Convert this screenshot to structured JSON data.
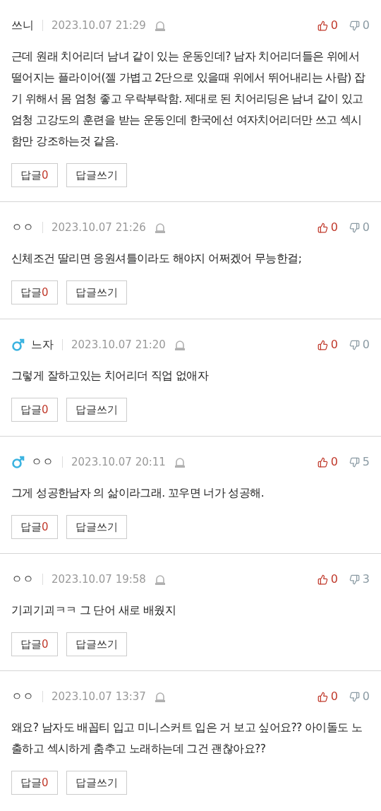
{
  "comments": [
    {
      "author": "쓰니",
      "male": false,
      "date": "2023.10.07 21:29",
      "likes": "0",
      "dislikes": "0",
      "text": "근데 원래 치어리더 남녀 같이 있는 운동인데? 남자 치어리더들은 위에서 떨어지는 플라이어(젤 가볍고 2단으로 있을때 위에서 뛰어내리는 사람) 잡기 위해서 몸 엄청 좋고 우락부락함. 제대로 된 치어리딩은 남녀 같이 있고 엄청 고강도의 훈련을 받는 운동인데 한국에선 여자치어리더만 쓰고 섹시함만 강조하는것 같음.",
      "reply_label": "답글",
      "reply_count": "0",
      "write_label": "답글쓰기"
    },
    {
      "author": "ㅇㅇ",
      "male": false,
      "date": "2023.10.07 21:26",
      "likes": "0",
      "dislikes": "0",
      "text": "신체조건 딸리면 응원셔틀이라도 해야지 어쩌겠어 무능한걸;",
      "reply_label": "답글",
      "reply_count": "0",
      "write_label": "답글쓰기"
    },
    {
      "author": "느자",
      "male": true,
      "date": "2023.10.07 21:20",
      "likes": "0",
      "dislikes": "0",
      "text": "그렇게 잘하고있는 치어리더 직업 없애자",
      "reply_label": "답글",
      "reply_count": "0",
      "write_label": "답글쓰기"
    },
    {
      "author": "ㅇㅇ",
      "male": true,
      "date": "2023.10.07 20:11",
      "likes": "0",
      "dislikes": "5",
      "text": "그게 성공한남자 의 삶이라그래. 꼬우면 너가 성공해.",
      "reply_label": "답글",
      "reply_count": "0",
      "write_label": "답글쓰기"
    },
    {
      "author": "ㅇㅇ",
      "male": false,
      "date": "2023.10.07 19:58",
      "likes": "0",
      "dislikes": "3",
      "text": "기괴기괴ㅋㅋ 그 단어 새로 배웠지",
      "reply_label": "답글",
      "reply_count": "0",
      "write_label": "답글쓰기"
    },
    {
      "author": "ㅇㅇ",
      "male": false,
      "date": "2023.10.07 13:37",
      "likes": "0",
      "dislikes": "0",
      "text": "왜요? 남자도 배꼽티 입고 미니스커트 입은 거 보고 싶어요?? 아이돌도 노출하고 섹시하게 춤추고 노래하는데 그건 괜찮아요??",
      "reply_label": "답글",
      "reply_count": "0",
      "write_label": "답글쓰기"
    }
  ]
}
